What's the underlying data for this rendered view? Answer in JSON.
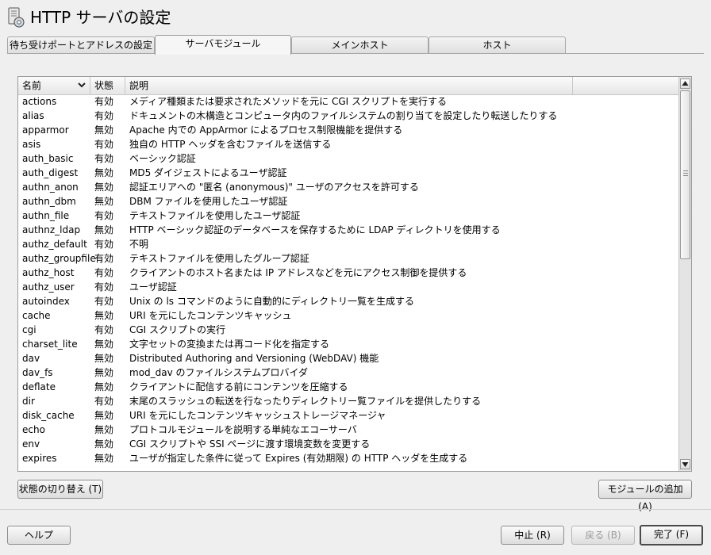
{
  "window": {
    "title": "HTTP サーバの設定",
    "icon": "server-settings-icon"
  },
  "tabs": [
    {
      "label": "待ち受けポートとアドレスの設定",
      "active": false
    },
    {
      "label": "サーバモジュール",
      "active": true
    },
    {
      "label": "メインホスト",
      "active": false
    },
    {
      "label": "ホスト",
      "active": false
    }
  ],
  "table": {
    "columns": {
      "name": "名前",
      "status": "状態",
      "description": "説明"
    },
    "rows": [
      {
        "name": "actions",
        "status": "有効",
        "desc": "メディア種類または要求されたメソッドを元に CGI スクリプトを実行する"
      },
      {
        "name": "alias",
        "status": "有効",
        "desc": "ドキュメントの木構造とコンピュータ内のファイルシステムの割り当てを設定したり転送したりする"
      },
      {
        "name": "apparmor",
        "status": "無効",
        "desc": "Apache 内での AppArmor によるプロセス制限機能を提供する"
      },
      {
        "name": "asis",
        "status": "有効",
        "desc": "独自の HTTP ヘッダを含むファイルを送信する"
      },
      {
        "name": "auth_basic",
        "status": "有効",
        "desc": "ベーシック認証"
      },
      {
        "name": "auth_digest",
        "status": "無効",
        "desc": "MD5 ダイジェストによるユーザ認証"
      },
      {
        "name": "authn_anon",
        "status": "無効",
        "desc": "認証エリアへの \"匿名 (anonymous)\" ユーザのアクセスを許可する"
      },
      {
        "name": "authn_dbm",
        "status": "無効",
        "desc": "DBM ファイルを使用したユーザ認証"
      },
      {
        "name": "authn_file",
        "status": "有効",
        "desc": "テキストファイルを使用したユーザ認証"
      },
      {
        "name": "authnz_ldap",
        "status": "無効",
        "desc": "HTTP ベーシック認証のデータベースを保存するために LDAP ディレクトリを使用する"
      },
      {
        "name": "authz_default",
        "status": "有効",
        "desc": "不明"
      },
      {
        "name": "authz_groupfile",
        "status": "有効",
        "desc": "テキストファイルを使用したグループ認証"
      },
      {
        "name": "authz_host",
        "status": "有効",
        "desc": "クライアントのホスト名または IP アドレスなどを元にアクセス制御を提供する"
      },
      {
        "name": "authz_user",
        "status": "有効",
        "desc": "ユーザ認証"
      },
      {
        "name": "autoindex",
        "status": "有効",
        "desc": "Unix の ls コマンドのように自動的にディレクトリ一覧を生成する"
      },
      {
        "name": "cache",
        "status": "無効",
        "desc": "URI を元にしたコンテンツキャッシュ"
      },
      {
        "name": "cgi",
        "status": "有効",
        "desc": "CGI スクリプトの実行"
      },
      {
        "name": "charset_lite",
        "status": "無効",
        "desc": "文字セットの変換または再コード化を指定する"
      },
      {
        "name": "dav",
        "status": "無効",
        "desc": "Distributed Authoring and Versioning (WebDAV) 機能"
      },
      {
        "name": "dav_fs",
        "status": "無効",
        "desc": "mod_dav のファイルシステムプロバイダ"
      },
      {
        "name": "deflate",
        "status": "無効",
        "desc": "クライアントに配信する前にコンテンツを圧縮する"
      },
      {
        "name": "dir",
        "status": "有効",
        "desc": "末尾のスラッシュの転送を行なったりディレクトリー覧ファイルを提供したりする"
      },
      {
        "name": "disk_cache",
        "status": "無効",
        "desc": "URI を元にしたコンテンツキャッシュストレージマネージャ"
      },
      {
        "name": "echo",
        "status": "無効",
        "desc": "プロトコルモジュールを説明する単純なエコーサーバ"
      },
      {
        "name": "env",
        "status": "無効",
        "desc": "CGI スクリプトや SSI ページに渡す環境変数を変更する"
      },
      {
        "name": "expires",
        "status": "無効",
        "desc": "ユーザが指定した条件に従って Expires (有効期限) の HTTP ヘッダを生成する"
      }
    ]
  },
  "buttons": {
    "toggle_status": "状態の切り替え (T)",
    "add_module": "モジュールの追加 (A)",
    "help": "ヘルプ",
    "abort": "中止 (R)",
    "back": "戻る (B)",
    "finish": "完了 (F)"
  },
  "colors": {
    "window_bg": "#efefef",
    "list_bg": "#ffffff",
    "border": "#9c9c9c"
  }
}
